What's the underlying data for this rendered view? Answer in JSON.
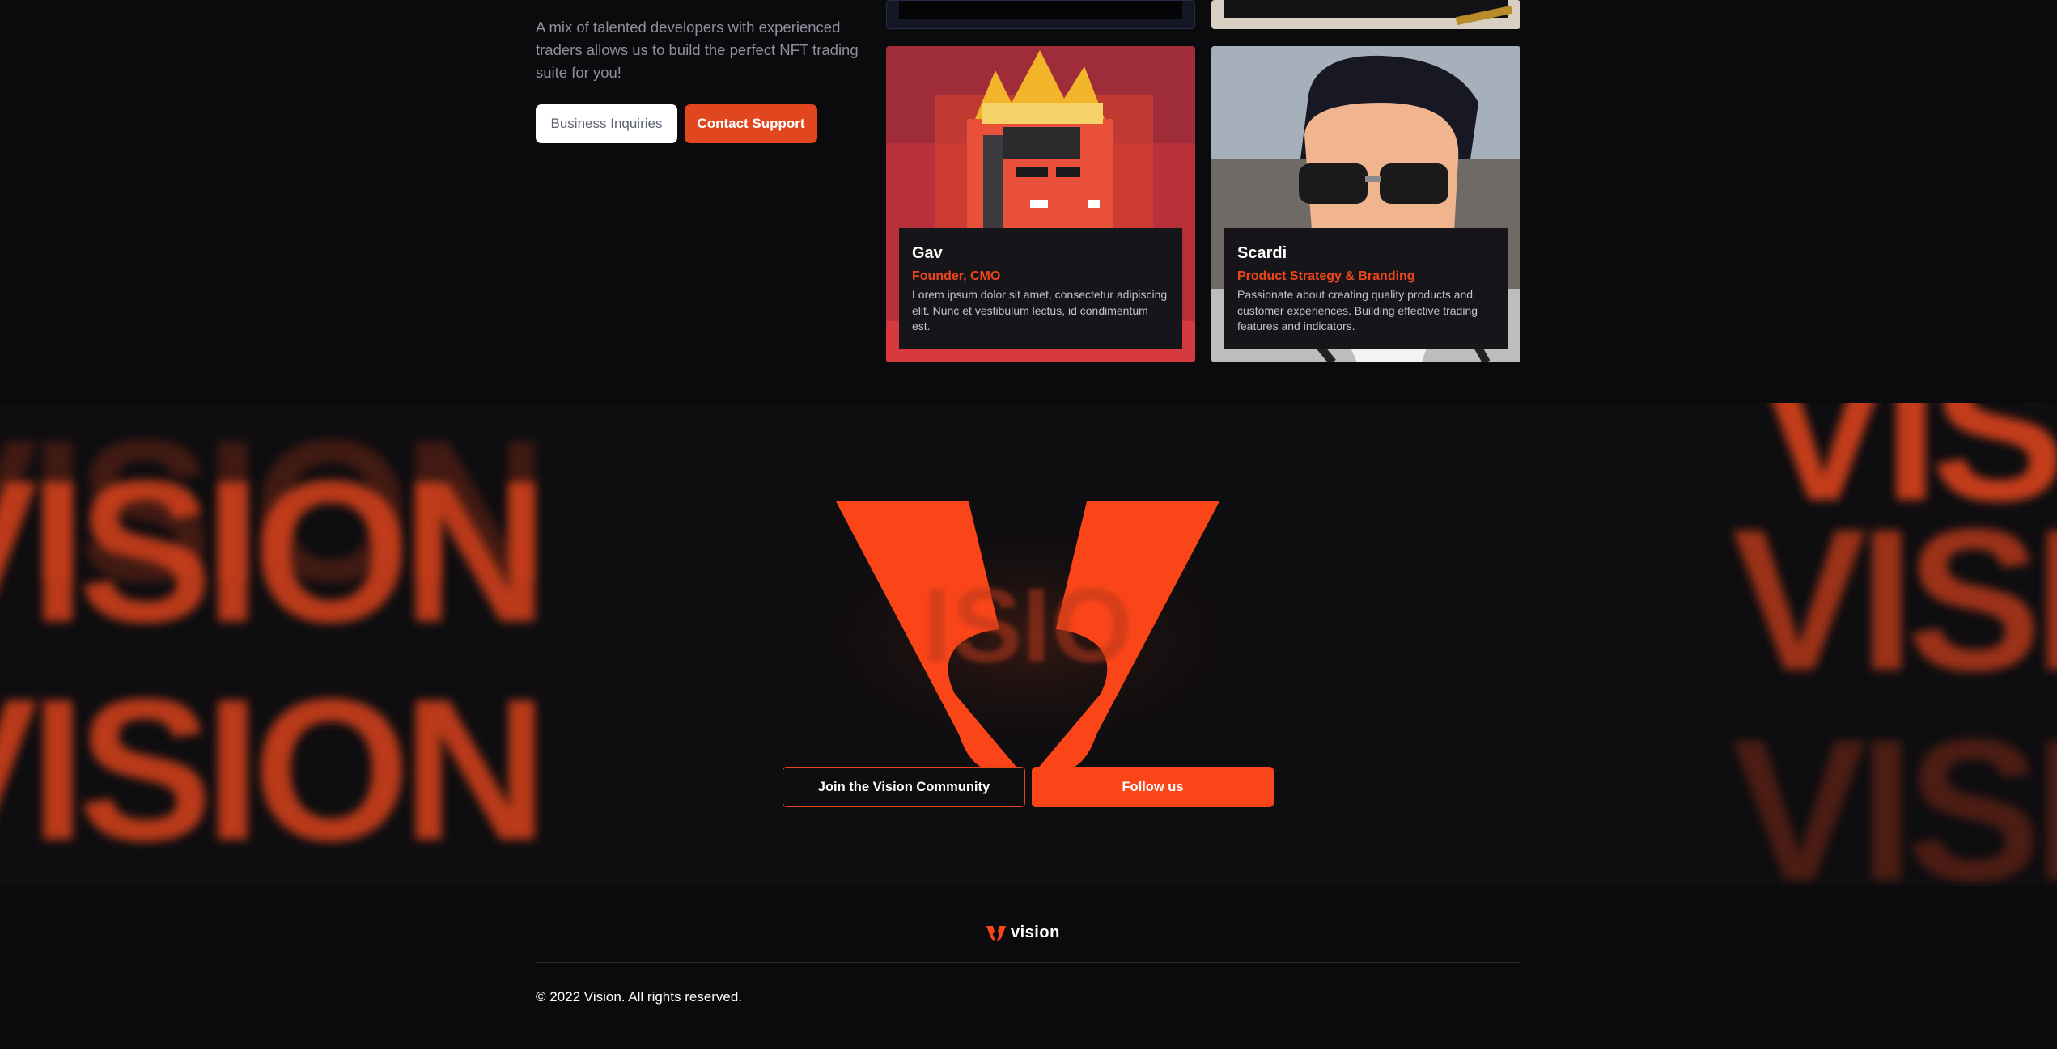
{
  "intro": {
    "text": "A mix of talented developers with experienced traders allows us to build the perfect NFT trading suite for you!",
    "business_label": "Business Inquiries",
    "support_label": "Contact Support"
  },
  "team": [
    {
      "name": "Gav",
      "role": "Founder, CMO",
      "bio": "Lorem ipsum dolor sit amet, consectetur adipiscing elit. Nunc et vestibulum lectus, id condimentum est."
    },
    {
      "name": "Scardi",
      "role": "Product Strategy & Branding",
      "bio": "Passionate about creating quality products and customer experiences. Building effective trading features and indicators."
    }
  ],
  "community": {
    "background_word": "VISION",
    "join_label": "Join the Vision Community",
    "follow_label": "Follow us"
  },
  "footer": {
    "brand": "vision",
    "copyright": "© 2022 Vision. All rights reserved."
  },
  "colors": {
    "accent": "#fa4519",
    "background": "#0b0b0e"
  }
}
